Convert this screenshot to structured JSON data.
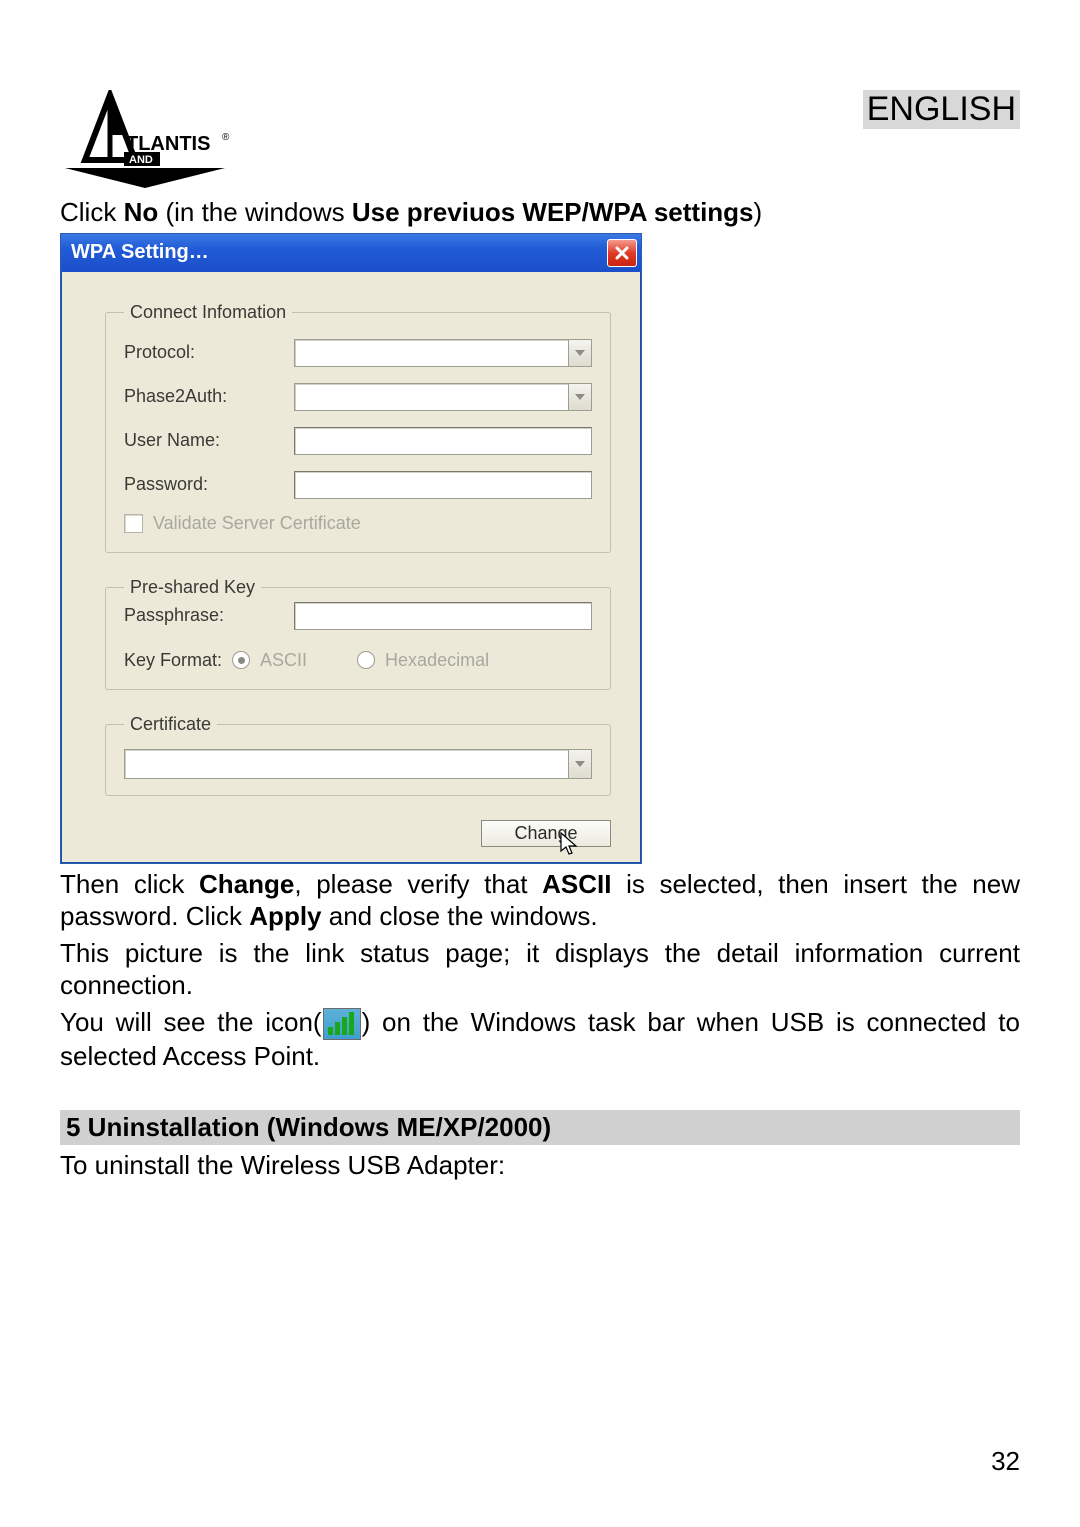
{
  "header": {
    "logo_name": "TLANTIS",
    "logo_sub": "AND",
    "language": "ENGLISH"
  },
  "instructions": {
    "line1_pre": "Click ",
    "line1_bold1": "No",
    "line1_mid": " (in the windows ",
    "line1_bold2": "Use previuos WEP/WPA settings",
    "line1_post": ")"
  },
  "dialog": {
    "title": "WPA Setting…",
    "groups": {
      "connect": {
        "legend": "Connect Infomation",
        "protocol_label": "Protocol:",
        "phase2_label": "Phase2Auth:",
        "username_label": "User Name:",
        "password_label": "Password:",
        "validate_label": "Validate Server Certificate"
      },
      "psk": {
        "legend": "Pre-shared Key",
        "passphrase_label": "Passphrase:",
        "keyformat_label": "Key Format:",
        "ascii_label": "ASCII",
        "hex_label": "Hexadecimal"
      },
      "cert": {
        "legend": "Certificate"
      }
    },
    "change_button": "Change"
  },
  "after": {
    "p1_a": "Then click ",
    "p1_b": "Change",
    "p1_c": ", please verify that ",
    "p1_d": "ASCII",
    "p1_e": " is selected, then  insert the new password.  Click ",
    "p1_f": "Apply",
    "p1_g": " and close the windows.",
    "p2": "This picture is the link status page; it displays the detail information current connection.",
    "p3_a": "You will see the icon(",
    "p3_b": ") on the Windows task bar when USB is connected to selected Access Point."
  },
  "section": {
    "heading": "5  Uninstallation (Windows ME/XP/2000)",
    "line": "To uninstall the Wireless USB Adapter:"
  },
  "page_number": "32"
}
